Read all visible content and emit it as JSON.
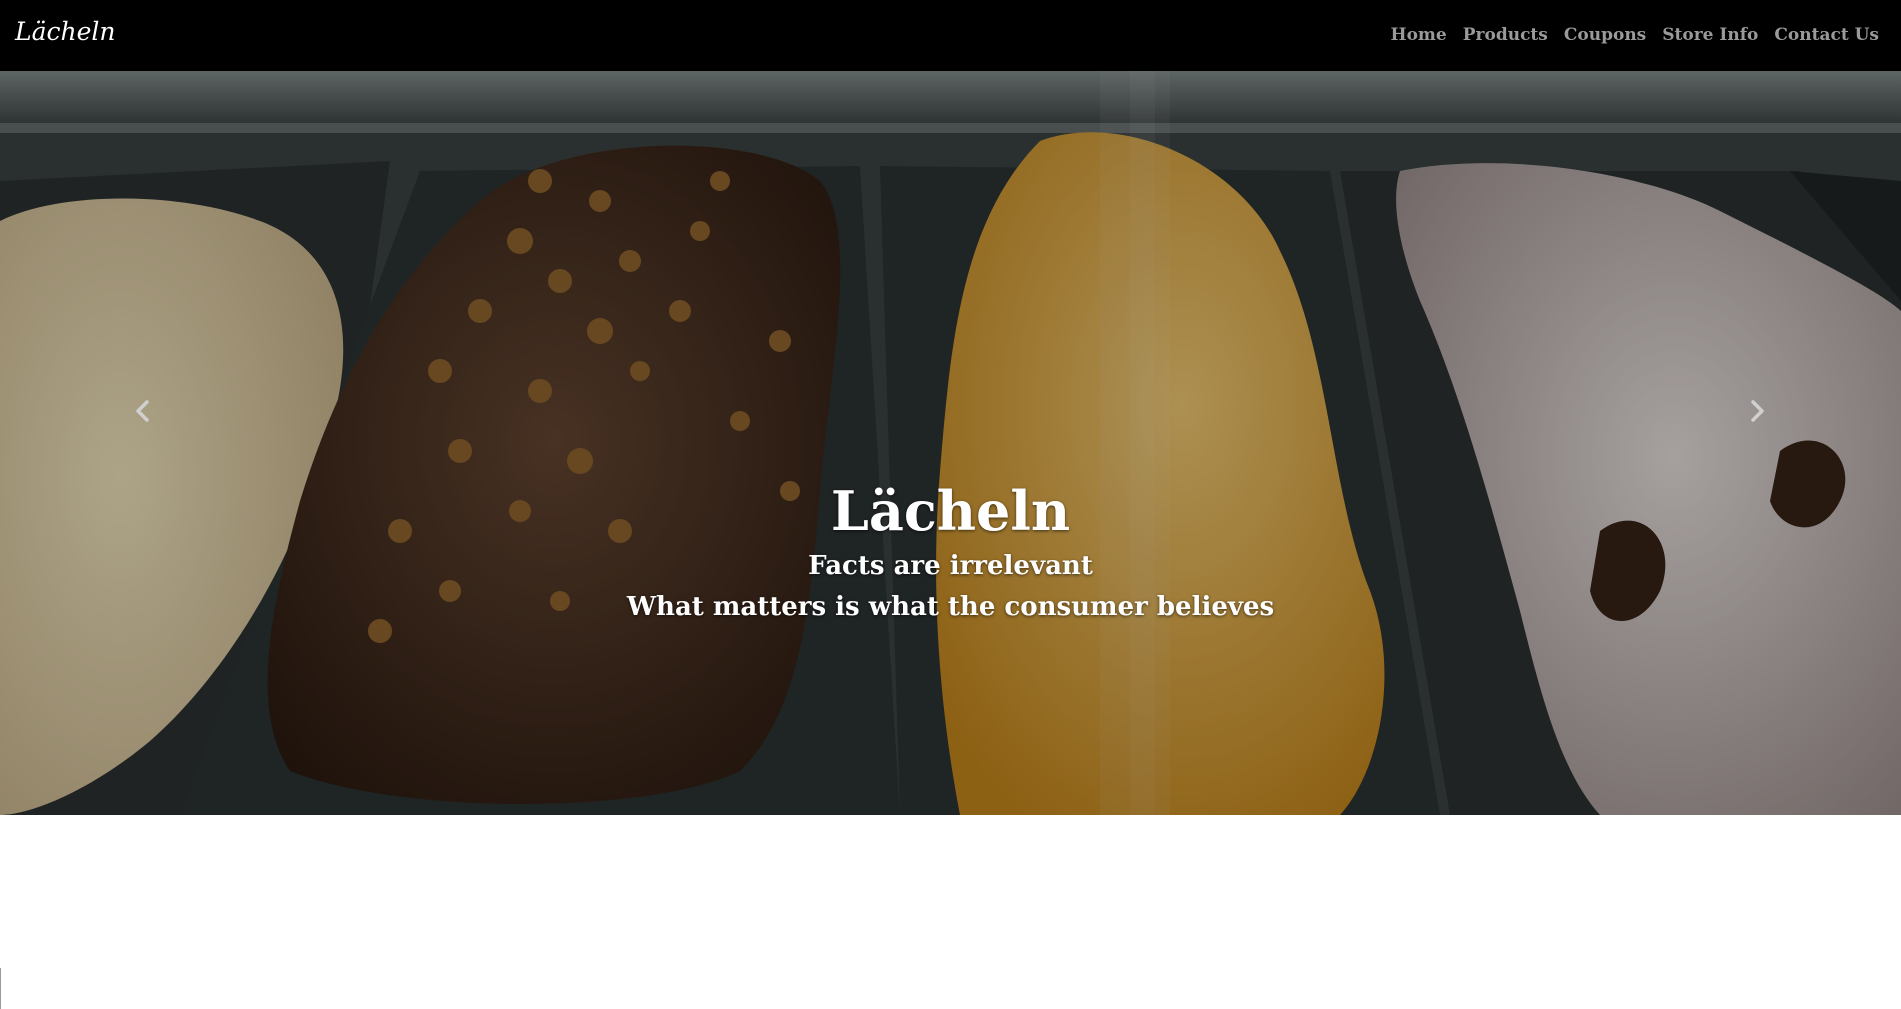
{
  "navbar": {
    "brand": "Lächeln",
    "links": [
      {
        "label": "Home"
      },
      {
        "label": "Products"
      },
      {
        "label": "Coupons"
      },
      {
        "label": "Store Info"
      },
      {
        "label": "Contact Us"
      }
    ]
  },
  "hero": {
    "title": "Lächeln",
    "subtitle_line1": "Facts are irrelevant",
    "subtitle_line2": "What matters is what the consumer believes",
    "prev_icon": "chevron-left-icon",
    "next_icon": "chevron-right-icon"
  },
  "colors": {
    "navbar_bg": "#000000",
    "nav_link": "#9a9a9a",
    "brand_text": "#ffffff"
  }
}
